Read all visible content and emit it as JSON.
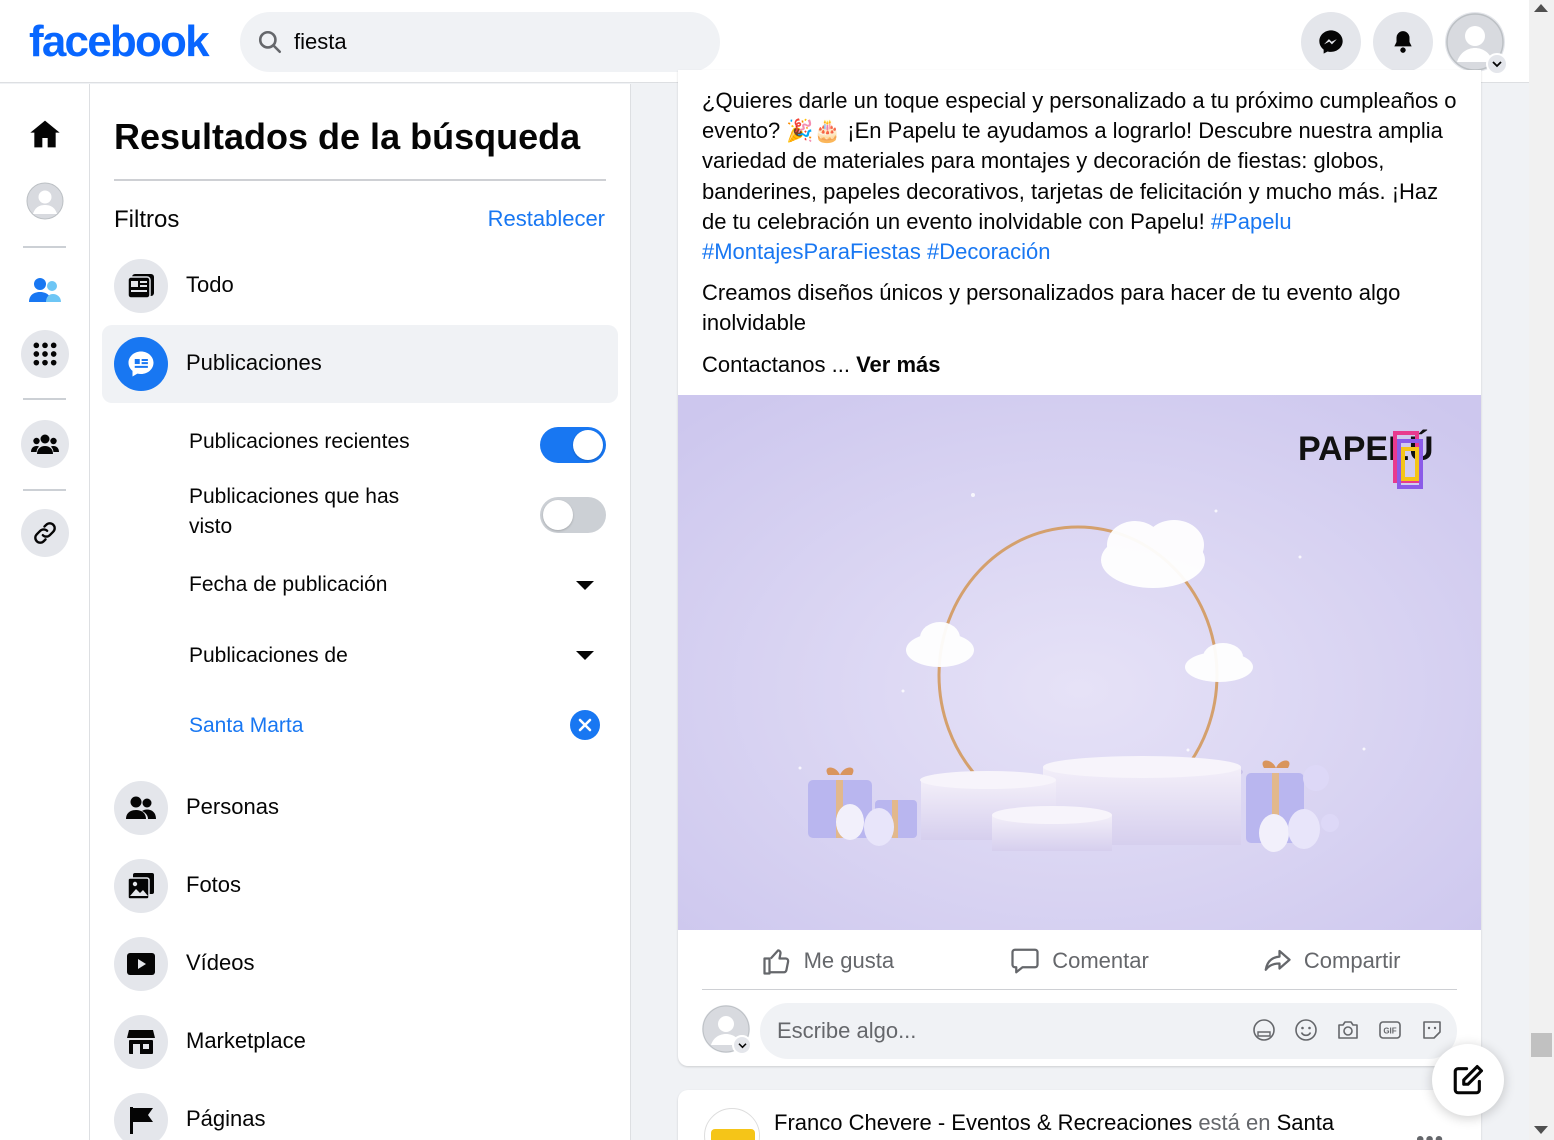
{
  "header": {
    "logo": "facebook",
    "search_value": "fiesta",
    "brand_color": "#0866ff"
  },
  "panel": {
    "title": "Resultados de la búsqueda",
    "filters_label": "Filtros",
    "reset_label": "Restablecer",
    "categories": [
      {
        "label": "Todo",
        "icon": "feed-icon"
      },
      {
        "label": "Publicaciones",
        "icon": "post-bubble-icon",
        "active": true
      },
      {
        "label": "Personas",
        "icon": "people-icon"
      },
      {
        "label": "Fotos",
        "icon": "photos-icon"
      },
      {
        "label": "Vídeos",
        "icon": "video-icon"
      },
      {
        "label": "Marketplace",
        "icon": "shop-icon"
      },
      {
        "label": "Páginas",
        "icon": "flag-icon"
      }
    ],
    "sub_filters": {
      "recent_label": "Publicaciones recientes",
      "recent_on": true,
      "seen_label_1": "Publicaciones que has",
      "seen_label_2": "visto",
      "seen_on": false,
      "date_label": "Fecha de publicación",
      "from_label": "Publicaciones de",
      "location_label": "Santa Marta"
    }
  },
  "post": {
    "text_1": "¿Quieres darle un toque especial y personalizado a tu próximo cumpleaños o evento? 🎉🎂 ¡En Papelu te ayudamos a lograrlo! Descubre nuestra amplia variedad de materiales para montajes y decoración de fiestas: globos, banderines, papeles decorativos, tarjetas de felicitación y mucho más. ¡Haz de tu celebración un evento inolvidable con Papelu! ",
    "hashtag_1": "#Papelu",
    "hashtag_2": "#MontajesParaFiestas",
    "hashtag_3": "#Decoración",
    "text_2": "Creamos diseños únicos y personalizados para hacer de tu evento algo inolvidable",
    "text_3": "Contactanos ... ",
    "see_more": "Ver más",
    "image_logo": "PAPELÚ",
    "actions": {
      "like": "Me gusta",
      "comment": "Comentar",
      "share": "Compartir"
    },
    "comment_placeholder": "Escribe algo..."
  },
  "next_post": {
    "author": "Franco Chevere - Eventos & Recreaciones",
    "connector": " está en ",
    "place": "Santa",
    "more": "•••"
  }
}
